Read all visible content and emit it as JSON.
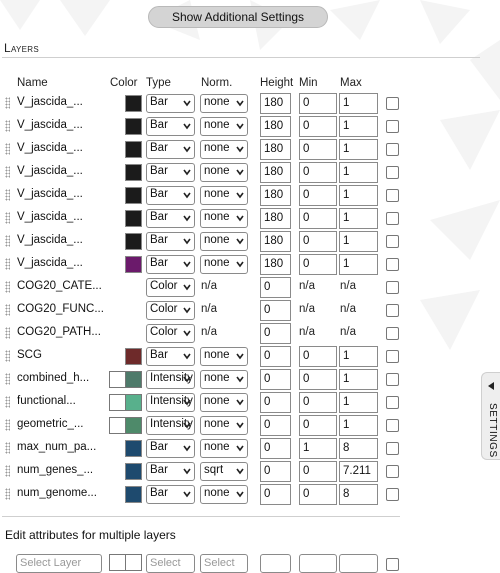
{
  "header": {
    "show_settings_label": "Show Additional Settings"
  },
  "section": {
    "title": "Layers"
  },
  "columns": {
    "name": "Name",
    "color": "Color",
    "type": "Type",
    "norm": "Norm.",
    "height": "Height",
    "min": "Min",
    "max": "Max"
  },
  "layers": [
    {
      "name": "V_jascida_...",
      "color": "#1b1b1b",
      "type": "Bar",
      "norm": "none",
      "height": "180",
      "min": "0",
      "max": "1"
    },
    {
      "name": "V_jascida_...",
      "color": "#1b1b1b",
      "type": "Bar",
      "norm": "none",
      "height": "180",
      "min": "0",
      "max": "1"
    },
    {
      "name": "V_jascida_...",
      "color": "#1b1b1b",
      "type": "Bar",
      "norm": "none",
      "height": "180",
      "min": "0",
      "max": "1"
    },
    {
      "name": "V_jascida_...",
      "color": "#1b1b1b",
      "type": "Bar",
      "norm": "none",
      "height": "180",
      "min": "0",
      "max": "1"
    },
    {
      "name": "V_jascida_...",
      "color": "#1b1b1b",
      "type": "Bar",
      "norm": "none",
      "height": "180",
      "min": "0",
      "max": "1"
    },
    {
      "name": "V_jascida_...",
      "color": "#1b1b1b",
      "type": "Bar",
      "norm": "none",
      "height": "180",
      "min": "0",
      "max": "1"
    },
    {
      "name": "V_jascida_...",
      "color": "#1b1b1b",
      "type": "Bar",
      "norm": "none",
      "height": "180",
      "min": "0",
      "max": "1"
    },
    {
      "name": "V_jascida_...",
      "color": "#6b1a6b",
      "type": "Bar",
      "norm": "none",
      "height": "180",
      "min": "0",
      "max": "1"
    },
    {
      "name": "COG20_CATE...",
      "type": "Color",
      "norm_text": "n/a",
      "height": "0",
      "min_text": "n/a",
      "max_text": "n/a"
    },
    {
      "name": "COG20_FUNC...",
      "type": "Color",
      "norm_text": "n/a",
      "height": "0",
      "min_text": "n/a",
      "max_text": "n/a"
    },
    {
      "name": "COG20_PATH...",
      "type": "Color",
      "norm_text": "n/a",
      "height": "0",
      "min_text": "n/a",
      "max_text": "n/a"
    },
    {
      "name": "SCG",
      "color": "#6e2a2a",
      "type": "Bar",
      "norm": "none",
      "height": "0",
      "min": "0",
      "max": "1"
    },
    {
      "name": "combined_h...",
      "color_low": "#ffffff",
      "color": "#4e7a6a",
      "type": "Intensity",
      "norm": "none",
      "height": "0",
      "min": "0",
      "max": "1"
    },
    {
      "name": "functional...",
      "color_low": "#ffffff",
      "color": "#58b08c",
      "type": "Intensity",
      "norm": "none",
      "height": "0",
      "min": "0",
      "max": "1"
    },
    {
      "name": "geometric_...",
      "color_low": "#ffffff",
      "color": "#4e8a6a",
      "type": "Intensity",
      "norm": "none",
      "height": "0",
      "min": "0",
      "max": "1"
    },
    {
      "name": "max_num_pa...",
      "color": "#1e4a6e",
      "type": "Bar",
      "norm": "none",
      "height": "0",
      "min": "1",
      "max": "8"
    },
    {
      "name": "num_genes_...",
      "color": "#1e4a6e",
      "type": "Bar",
      "norm": "sqrt",
      "height": "0",
      "min": "0",
      "max": "7.211"
    },
    {
      "name": "num_genome...",
      "color": "#1e4a6e",
      "type": "Bar",
      "norm": "none",
      "height": "0",
      "min": "0",
      "max": "8"
    }
  ],
  "multi_edit": {
    "title": "Edit attributes for multiple layers",
    "layer_placeholder": "Select Layer",
    "type_placeholder": "Select",
    "norm_placeholder": "Select"
  },
  "side_tab": {
    "label": "SETTINGS"
  },
  "colors": {
    "button_bg": "#d4d4d4",
    "rule": "#cfcfcf"
  }
}
